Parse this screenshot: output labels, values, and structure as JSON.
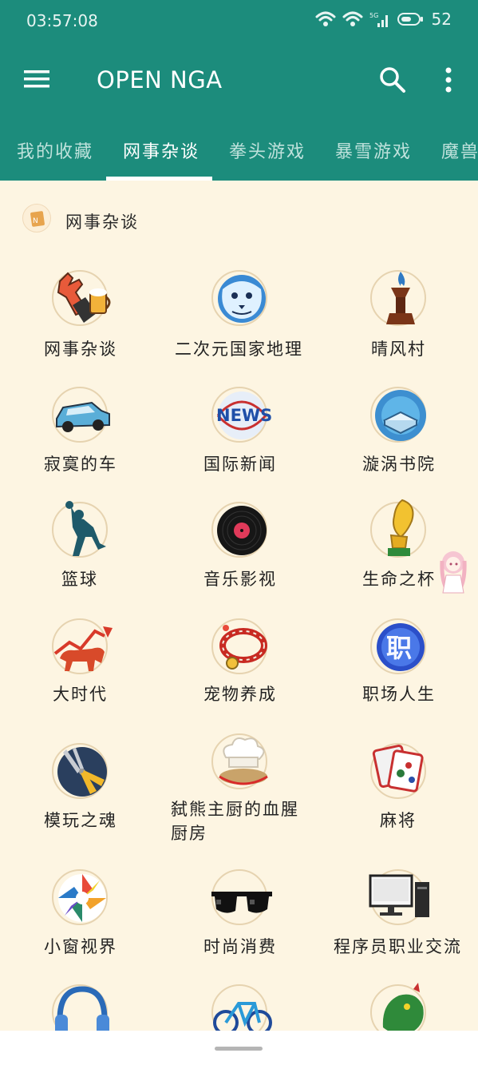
{
  "status": {
    "time": "03:57:08",
    "battery": "52",
    "network": "5G"
  },
  "app": {
    "title": "OPEN NGA"
  },
  "tabs": [
    {
      "label": "我的收藏",
      "active": false
    },
    {
      "label": "网事杂谈",
      "active": true
    },
    {
      "label": "拳头游戏",
      "active": false
    },
    {
      "label": "暴雪游戏",
      "active": false
    },
    {
      "label": "魔兽",
      "active": false
    }
  ],
  "section": {
    "title": "网事杂谈"
  },
  "boards": [
    {
      "label": "网事杂谈",
      "icon": "beer-hand-icon"
    },
    {
      "label": "二次元国家地理",
      "icon": "snow-leopard-icon"
    },
    {
      "label": "晴风村",
      "icon": "torch-icon"
    },
    {
      "label": "寂寞的车",
      "icon": "car-icon"
    },
    {
      "label": "国际新闻",
      "icon": "news-globe-icon"
    },
    {
      "label": "漩涡书院",
      "icon": "book-icon"
    },
    {
      "label": "篮球",
      "icon": "basketball-player-icon"
    },
    {
      "label": "音乐影视",
      "icon": "vinyl-record-icon"
    },
    {
      "label": "生命之杯",
      "icon": "world-cup-icon"
    },
    {
      "label": "大时代",
      "icon": "bull-icon"
    },
    {
      "label": "宠物养成",
      "icon": "pet-collar-icon"
    },
    {
      "label": "职场人生",
      "icon": "career-badge-icon"
    },
    {
      "label": "模玩之魂",
      "icon": "pliers-icon"
    },
    {
      "label": "弑熊主厨的血腥厨房",
      "icon": "chef-hat-icon"
    },
    {
      "label": "麻将",
      "icon": "mahjong-icon"
    },
    {
      "label": "小窗视界",
      "icon": "camera-aperture-icon"
    },
    {
      "label": "时尚消费",
      "icon": "sunglasses-icon"
    },
    {
      "label": "程序员职业交流",
      "icon": "computer-icon"
    },
    {
      "label": "",
      "icon": "headphones-icon"
    },
    {
      "label": "",
      "icon": "bicycle-icon"
    },
    {
      "label": "",
      "icon": "dragon-icon"
    }
  ],
  "colors": {
    "primary": "#1c8c7c",
    "background": "#fdf5e2",
    "accent_white": "#ffffff"
  }
}
